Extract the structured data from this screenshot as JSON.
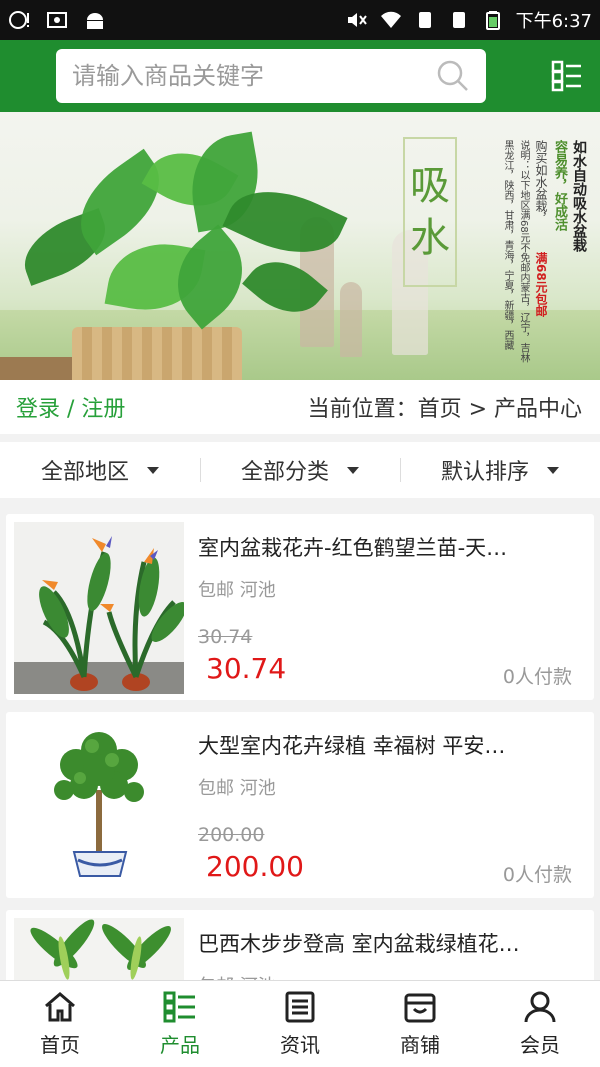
{
  "status_bar": {
    "time": "下午6:37"
  },
  "header": {
    "search_placeholder": "请输入商品关键字"
  },
  "banner": {
    "headline": "如水自动吸水盆栽",
    "tagline": "容易养，好成活",
    "promo_prefix": "购买如水盆栽，",
    "promo_highlight": "满68元包邮",
    "promo_note_a": "说明：以下地区满68元不免邮内蒙古，辽宁，吉林",
    "promo_note_b": "黑龙江，陕西，甘肃，青海，宁夏，新疆，西藏",
    "calligraphy": [
      "吸",
      "水"
    ]
  },
  "crumb": {
    "login": "登录 / 注册",
    "location": "当前位置：首页 > 产品中心"
  },
  "filters": [
    {
      "label": "全部地区"
    },
    {
      "label": "全部分类"
    },
    {
      "label": "默认排序"
    }
  ],
  "products": [
    {
      "title": "室内盆栽花卉-红色鹤望兰苗-天…",
      "meta": "包邮 河池",
      "old_price": "30.74",
      "price": "30.74",
      "paid": "0人付款"
    },
    {
      "title": "大型室内花卉绿植 幸福树 平安…",
      "meta": "包邮 河池",
      "old_price": "200.00",
      "price": "200.00",
      "paid": "0人付款"
    },
    {
      "title": "巴西木步步登高 室内盆栽绿植花…",
      "meta": "包邮 河池",
      "old_price": "",
      "price": "",
      "paid": ""
    }
  ],
  "tabs": [
    {
      "label": "首页",
      "icon": "home-icon"
    },
    {
      "label": "产品",
      "icon": "product-list-icon"
    },
    {
      "label": "资讯",
      "icon": "news-icon"
    },
    {
      "label": "商铺",
      "icon": "shop-icon"
    },
    {
      "label": "会员",
      "icon": "member-icon"
    }
  ],
  "colors": {
    "brand_green": "#1f8d2f",
    "price_red": "#e01818"
  }
}
